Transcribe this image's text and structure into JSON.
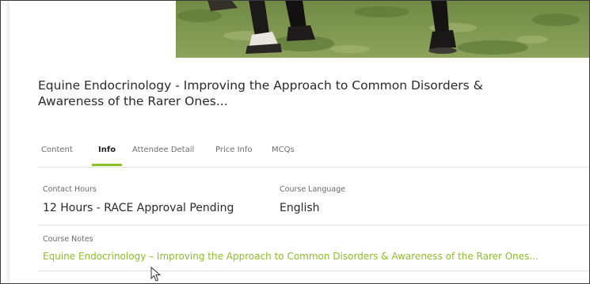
{
  "course": {
    "title": "Equine Endocrinology - Improving the Approach to Common Disorders & Awareness of the Rarer Ones..."
  },
  "tabs": [
    {
      "label": "Content",
      "active": false
    },
    {
      "label": "Info",
      "active": true
    },
    {
      "label": "Attendee Detail",
      "active": false
    },
    {
      "label": "Price Info",
      "active": false
    },
    {
      "label": "MCQs",
      "active": false
    }
  ],
  "info": {
    "contact_hours_label": "Contact Hours",
    "contact_hours_value": "12 Hours - RACE Approval Pending",
    "course_language_label": "Course Language",
    "course_language_value": "English",
    "course_notes_label": "Course Notes",
    "course_notes_value": "Equine Endocrinology – Improving the Approach to Common Disorders & Awareness of the Rarer Ones..."
  },
  "colors": {
    "accent": "#8cbf2a",
    "text": "#2a2a2a",
    "muted": "#6a6a6a",
    "divider": "#e4e4e4"
  },
  "icons": {
    "pointer": "mouse-pointer-icon"
  }
}
